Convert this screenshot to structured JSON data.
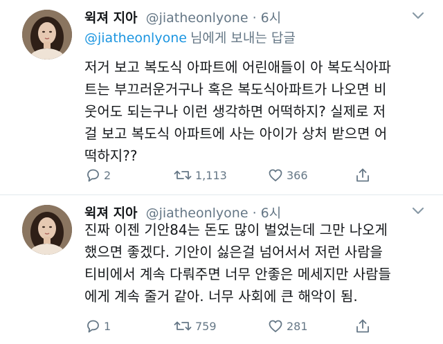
{
  "tweets": [
    {
      "display_name": "윅져 지아",
      "handle": "@jiatheonlyone",
      "separator": "·",
      "time": "6시",
      "reply_to": {
        "handle": "@jiatheonlyone",
        "suffix": "님에게 보내는 답글"
      },
      "body_lines": [
        "저거 보고 복도식 아파트에 어린애들이 아 복도식아파",
        "트는 부끄러운거구나 혹은 복도식아파트가 나오면 비",
        "웃어도 되는구나 이런 생각하면 어떡하지? 실제로 저",
        "걸 보고 복도식 아파트에 사는 아이가 상처 받으면 어",
        "떡하지??"
      ],
      "counts": {
        "replies": "2",
        "retweets": "1,113",
        "likes": "366"
      }
    },
    {
      "display_name": "윅져 지아",
      "handle": "@jiatheonlyone",
      "separator": "·",
      "time": "6시",
      "body_lines": [
        "진짜 이젠 기안84는 돈도 많이 벌었는데 그만 나오게",
        "했으면 좋겠다. 기안이 싫은걸 넘어서서 저런 사람을",
        "티비에서 계속 다뤄주면 너무 안좋은 메세지만 사람들",
        "에게 계속 줄거 같아. 너무 사회에 큰 해악이 됨."
      ],
      "counts": {
        "replies": "1",
        "retweets": "759",
        "likes": "281"
      }
    }
  ],
  "icons": {
    "reply": "reply-icon",
    "retweet": "retweet-icon",
    "like": "heart-icon",
    "share": "share-icon",
    "more": "chevron-down-icon"
  },
  "colors": {
    "link": "#1b95e0",
    "secondary_text": "#657786",
    "primary_text": "#14171a",
    "divider": "#e1e8ed"
  }
}
